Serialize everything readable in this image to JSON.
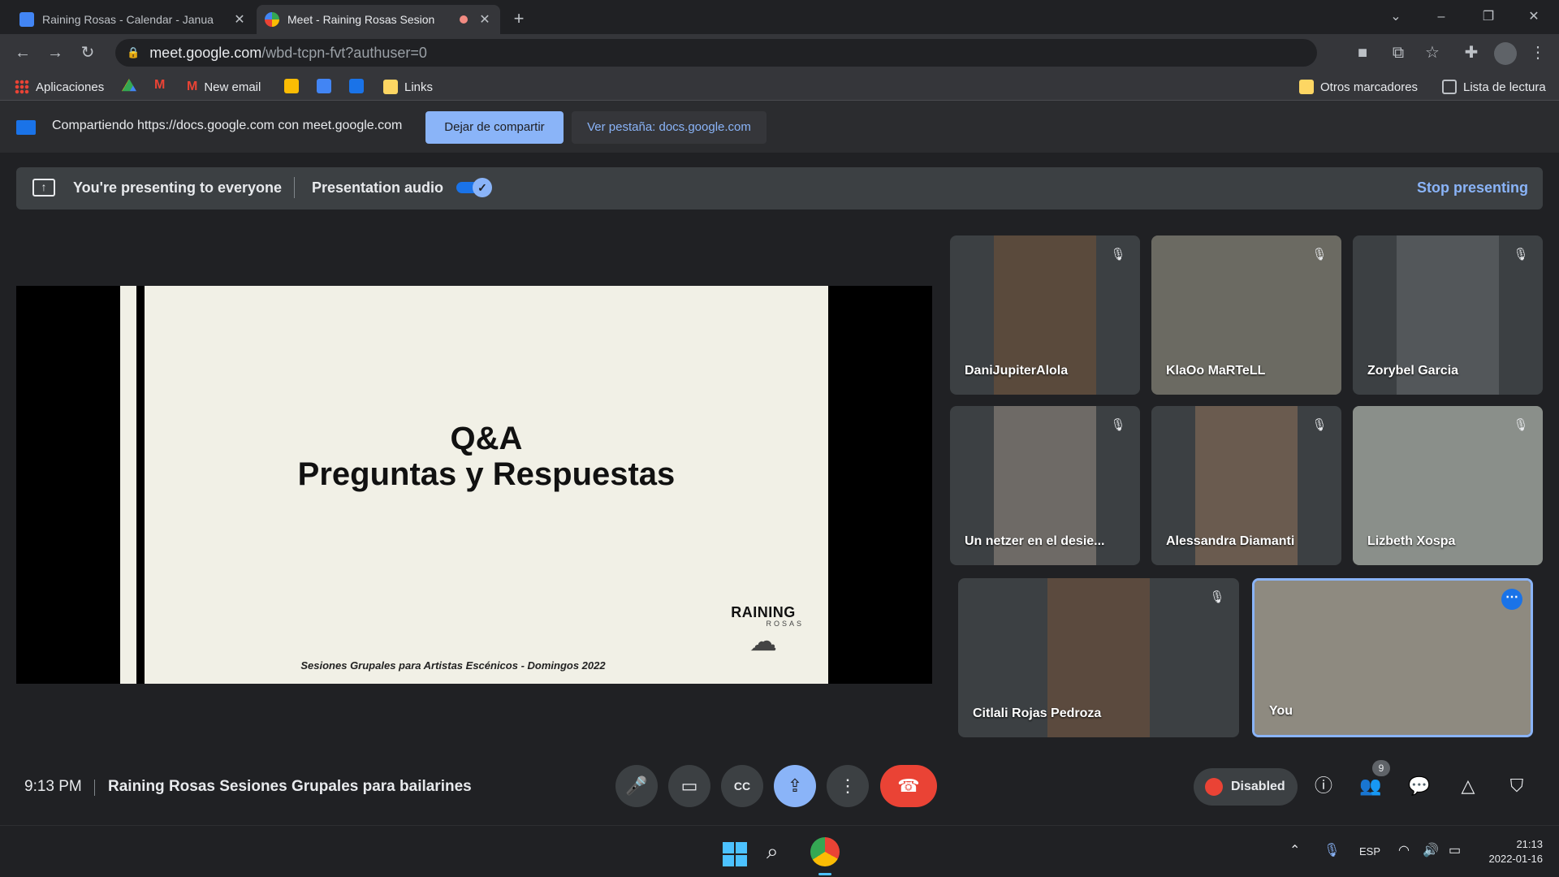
{
  "browser": {
    "tabs": [
      {
        "title": "Raining Rosas - Calendar - Janua",
        "close": "✕"
      },
      {
        "title": "Meet - Raining Rosas Sesion",
        "close": "✕"
      }
    ],
    "new_tab": "+",
    "url_host": "meet.google.com",
    "url_path": "/wbd-tcpn-fvt?authuser=0",
    "bookmarks": [
      {
        "label": "Aplicaciones"
      },
      {
        "label": "New email"
      },
      {
        "label": "Links"
      }
    ],
    "bookmarks_right": [
      {
        "label": "Otros marcadores"
      },
      {
        "label": "Lista de lectura"
      }
    ]
  },
  "sharebar": {
    "text": "Compartiendo https://docs.google.com con meet.google.com",
    "stop_label": "Dejar de compartir",
    "view_label": "Ver pestaña: docs.google.com"
  },
  "presentation": {
    "banner_text": "You're presenting to everyone",
    "audio_label": "Presentation audio",
    "audio_on": true,
    "stop_label": "Stop presenting"
  },
  "slide": {
    "title_line1": "Q&A",
    "title_line2": "Preguntas y Respuestas",
    "footer": "Sesiones Grupales para Artistas Escénicos - Domingos 2022",
    "logo_line1": "RAINING",
    "logo_line2": "ROSAS"
  },
  "participants": [
    {
      "name": "DaniJupiterAlola",
      "muted": true,
      "bg": "#5a4a3c"
    },
    {
      "name": "KlaOo MaRTeLL",
      "muted": true,
      "bg": "#6b6a62"
    },
    {
      "name": "Zorybel Garcia",
      "muted": true,
      "bg": "#53575a"
    },
    {
      "name": "Un netzer en el desie...",
      "muted": true,
      "bg": "#6e6a66"
    },
    {
      "name": "Alessandra Diamanti",
      "muted": true,
      "bg": "#6a5b4f"
    },
    {
      "name": "Lizbeth Xospa",
      "muted": true,
      "bg": "#8a8f8a"
    },
    {
      "name": "Citlali Rojas Pedroza",
      "muted": true,
      "bg": "#5b4a3e"
    },
    {
      "name": "You",
      "muted": false,
      "bg": "#8e8a80"
    }
  ],
  "footer": {
    "time": "9:13 PM",
    "meeting_title": "Raining Rosas Sesiones Grupales para bailarines",
    "disabled_label": "Disabled",
    "people_count": "9"
  },
  "taskbar": {
    "lang": "ESP",
    "clock_time": "21:13",
    "clock_date": "2022-01-16"
  },
  "colors": {
    "accent": "#8ab4f8",
    "danger": "#ea4335",
    "present_active": "#8ab4f8"
  }
}
